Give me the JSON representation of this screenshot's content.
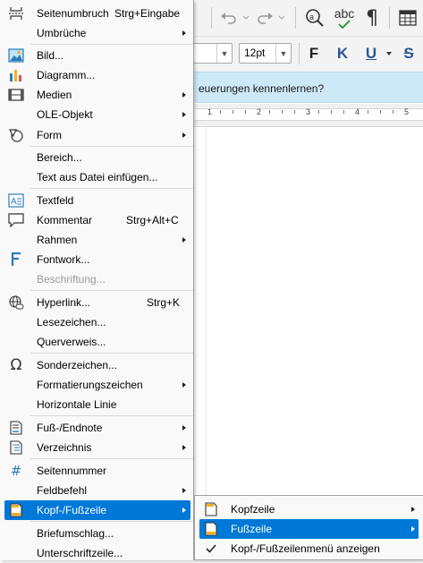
{
  "toolbar": {
    "font_size_value": "12pt",
    "bold_label": "F",
    "italic_label": "K",
    "underline_label": "U",
    "strike_label": "S",
    "spellcheck_label": "abc",
    "formatting_marks_label": "¶"
  },
  "infobar": {
    "text": "euerungen kennenlernen?"
  },
  "ruler": {
    "labels": [
      "1",
      "2",
      "3",
      "4",
      "5"
    ]
  },
  "menu": {
    "items": [
      {
        "label": "Seitenumbruch",
        "shortcut": "Strg+Eingabe",
        "icon": "page-break-icon"
      },
      {
        "label": "Umbrüche",
        "submenu": true
      },
      {
        "label": "Bild...",
        "icon": "image-icon"
      },
      {
        "label": "Diagramm...",
        "icon": "chart-icon"
      },
      {
        "label": "Medien",
        "icon": "media-icon",
        "submenu": true
      },
      {
        "label": "OLE-Objekt",
        "submenu": true
      },
      {
        "label": "Form",
        "icon": "shapes-icon",
        "submenu": true
      },
      {
        "label": "Bereich..."
      },
      {
        "label": "Text aus Datei einfügen..."
      },
      {
        "label": "Textfeld",
        "icon": "textbox-icon"
      },
      {
        "label": "Kommentar",
        "shortcut": "Strg+Alt+C",
        "icon": "comment-icon"
      },
      {
        "label": "Rahmen",
        "submenu": true
      },
      {
        "label": "Fontwork...",
        "icon": "fontwork-icon"
      },
      {
        "label": "Beschriftung...",
        "disabled": true
      },
      {
        "label": "Hyperlink...",
        "shortcut": "Strg+K",
        "icon": "hyperlink-icon"
      },
      {
        "label": "Lesezeichen..."
      },
      {
        "label": "Querverweis..."
      },
      {
        "label": "Sonderzeichen...",
        "icon": "omega-icon"
      },
      {
        "label": "Formatierungszeichen",
        "submenu": true
      },
      {
        "label": "Horizontale Linie"
      },
      {
        "label": "Fuß-/Endnote",
        "icon": "footnote-icon",
        "submenu": true
      },
      {
        "label": "Verzeichnis",
        "icon": "index-icon",
        "submenu": true
      },
      {
        "label": "Seitennummer",
        "icon": "page-number-icon"
      },
      {
        "label": "Feldbefehl",
        "submenu": true
      },
      {
        "label": "Kopf-/Fußzeile",
        "icon": "header-footer-icon",
        "submenu": true,
        "selected": true
      },
      {
        "label": "Briefumschlag..."
      },
      {
        "label": "Unterschriftzeile..."
      }
    ]
  },
  "submenu": {
    "items": [
      {
        "label": "Kopfzeile",
        "icon": "header-icon",
        "submenu": true
      },
      {
        "label": "Fußzeile",
        "icon": "footer-icon",
        "submenu": true,
        "selected": true
      },
      {
        "label": "Kopf-/Fußzeilenmenü anzeigen",
        "icon": "check-icon",
        "checked": true
      }
    ]
  },
  "colors": {
    "selection": "#0078d7",
    "infobar": "#cde8f6",
    "menu_bg": "#f9f9f9"
  }
}
